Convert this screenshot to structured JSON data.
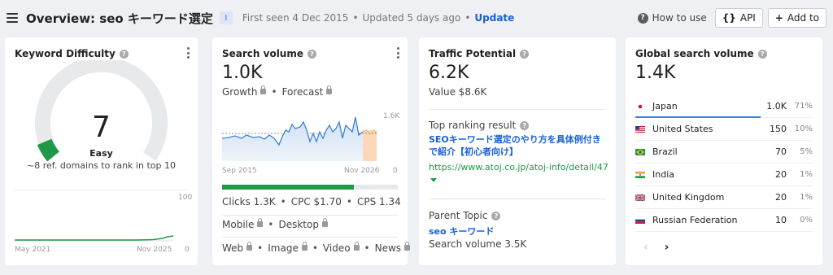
{
  "header": {
    "title": "Overview: seo キーワード選定",
    "info_badge": "I",
    "first_seen": "First seen 4 Dec 2015",
    "updated": "Updated 5 days ago",
    "update_link": "Update",
    "how_to_use": "How to use",
    "api_button": "API",
    "add_to_button": "Add to"
  },
  "keyword_difficulty": {
    "title": "Keyword Difficulty",
    "value": "7",
    "label": "Easy",
    "description": "~8 ref. domains to rank in top 10",
    "chart": {
      "x_start": "May 2021",
      "x_end": "Nov 2025",
      "y_max": "100",
      "y_min": "0"
    }
  },
  "search_volume": {
    "title": "Search volume",
    "value": "1.0K",
    "growth_label": "Growth",
    "forecast_label": "Forecast",
    "chart": {
      "y_max": "1.6K",
      "y_min": "0",
      "x_start": "Sep 2015",
      "x_end": "Nov 2026"
    },
    "progress_fraction": 0.75,
    "clicks": "Clicks 1.3K",
    "cpc": "CPC $1.70",
    "cps": "CPS 1.34",
    "mobile": "Mobile",
    "desktop": "Desktop",
    "web": "Web",
    "image": "Image",
    "video": "Video",
    "news": "News"
  },
  "traffic_potential": {
    "title": "Traffic Potential",
    "value": "6.2K",
    "value_usd": "Value $8.6K",
    "top_result_label": "Top ranking result",
    "top_result_title": "SEOキーワード選定のやり方を具体例付きで紹介【初心者向け】",
    "top_result_url": "https://www.atoj.co.jp/atoj-info/detail/47",
    "parent_topic_label": "Parent Topic",
    "parent_topic": "seo キーワード",
    "parent_volume": "Search volume 3.5K"
  },
  "global_volume": {
    "title": "Global search volume",
    "value": "1.4K",
    "rows": [
      {
        "country": "Japan",
        "volume": "1.0K",
        "percent": "71%"
      },
      {
        "country": "United States",
        "volume": "150",
        "percent": "10%"
      },
      {
        "country": "Brazil",
        "volume": "70",
        "percent": "5%"
      },
      {
        "country": "India",
        "volume": "20",
        "percent": "1%"
      },
      {
        "country": "United Kingdom",
        "volume": "20",
        "percent": "1%"
      },
      {
        "country": "Russian Federation",
        "volume": "10",
        "percent": "0%"
      }
    ],
    "prev_icon": "chevron-left-icon",
    "next_icon": "chevron-right-icon"
  },
  "colors": {
    "accent_blue": "#1a5fd6",
    "kd_green": "#1e9a46",
    "forecast_orange": "#f0a35e",
    "chart_blue": "#3b82d6"
  }
}
